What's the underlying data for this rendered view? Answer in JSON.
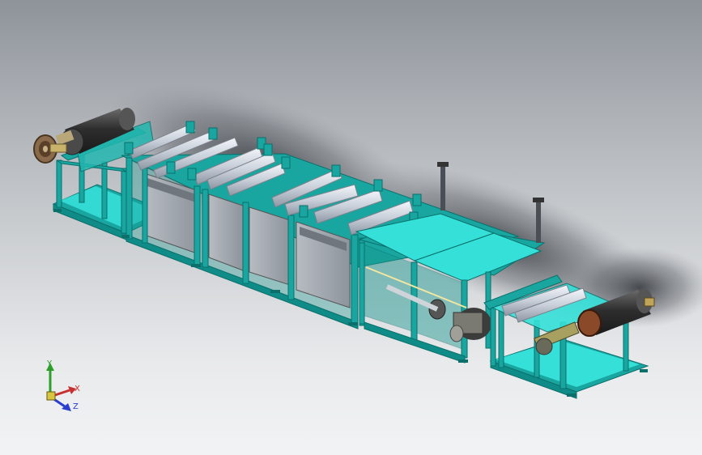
{
  "view": {
    "type": "cad-3d-model-viewport",
    "background": {
      "top": "#8e939a",
      "bottom": "#f2f3f4"
    },
    "colors": {
      "frame": "#1aa6a0",
      "frame_dark": "#0b6f6b",
      "cover": "#35e0d8",
      "roller": "#d4dae4",
      "roll_dark": "#3d3d3d",
      "tank": "#9aa1a8",
      "motor": "#7a7a72"
    }
  },
  "triad": {
    "x_label": "X",
    "y_label": "Y",
    "z_label": "Z",
    "x_color": "#c83030",
    "y_color": "#2aa02a",
    "z_color": "#2a3fd0"
  }
}
